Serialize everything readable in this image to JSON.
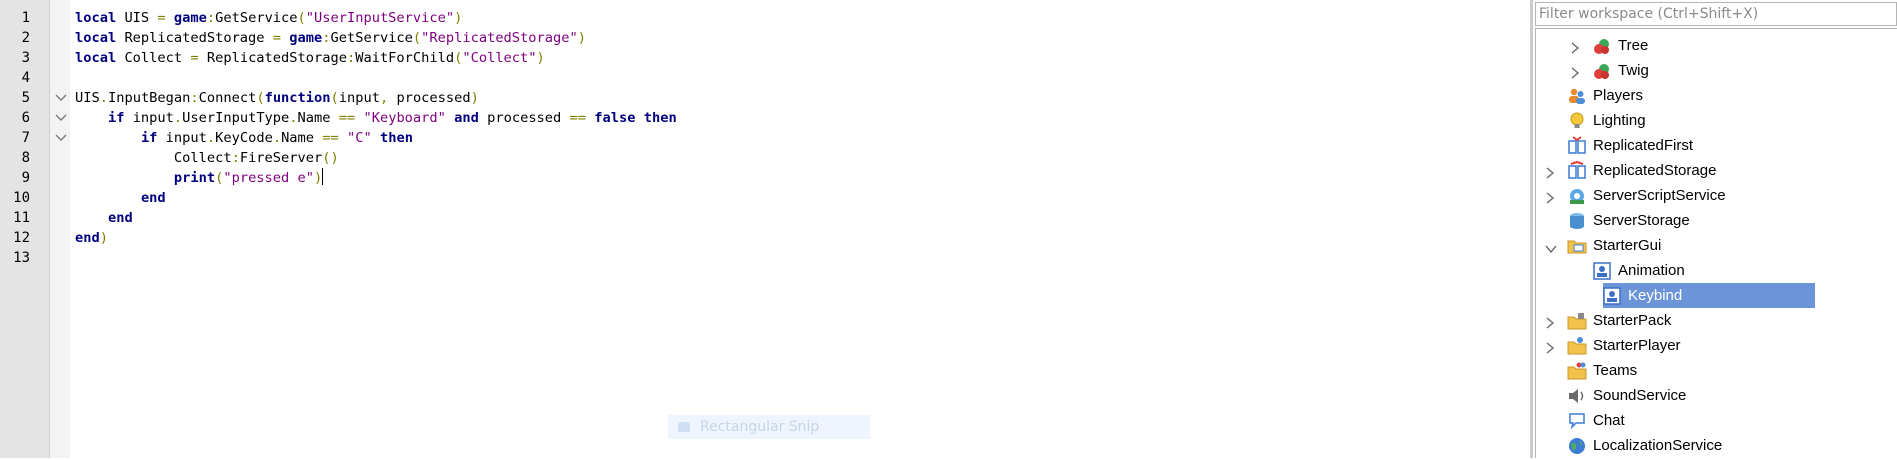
{
  "editor": {
    "line_numbers": [
      "1",
      "2",
      "3",
      "4",
      "5",
      "6",
      "7",
      "8",
      "9",
      "10",
      "11",
      "12",
      "13"
    ],
    "lines": [
      [
        [
          "local",
          "kw"
        ],
        [
          " UIS ",
          "id"
        ],
        [
          "=",
          "op"
        ],
        [
          " ",
          "id"
        ],
        [
          "game",
          "kw"
        ],
        [
          ":",
          "op"
        ],
        [
          "GetService",
          "id"
        ],
        [
          "(",
          "op"
        ],
        [
          "\"UserInputService\"",
          "str"
        ],
        [
          ")",
          "op"
        ]
      ],
      [
        [
          "local",
          "kw"
        ],
        [
          " ReplicatedStorage ",
          "id"
        ],
        [
          "=",
          "op"
        ],
        [
          " ",
          "id"
        ],
        [
          "game",
          "kw"
        ],
        [
          ":",
          "op"
        ],
        [
          "GetService",
          "id"
        ],
        [
          "(",
          "op"
        ],
        [
          "\"ReplicatedStorage\"",
          "str"
        ],
        [
          ")",
          "op"
        ]
      ],
      [
        [
          "local",
          "kw"
        ],
        [
          " Collect ",
          "id"
        ],
        [
          "=",
          "op"
        ],
        [
          " ReplicatedStorage",
          "id"
        ],
        [
          ":",
          "op"
        ],
        [
          "WaitForChild",
          "id"
        ],
        [
          "(",
          "op"
        ],
        [
          "\"Collect\"",
          "str"
        ],
        [
          ")",
          "op"
        ]
      ],
      [],
      [
        [
          "UIS",
          "id"
        ],
        [
          ".",
          "op"
        ],
        [
          "InputBegan",
          "id"
        ],
        [
          ":",
          "op"
        ],
        [
          "Connect",
          "id"
        ],
        [
          "(",
          "op"
        ],
        [
          "function",
          "kw"
        ],
        [
          "(",
          "op"
        ],
        [
          "input",
          "id"
        ],
        [
          ",",
          "op"
        ],
        [
          " processed",
          "id"
        ],
        [
          ")",
          "op"
        ]
      ],
      [
        [
          "    ",
          "id"
        ],
        [
          "if",
          "kw"
        ],
        [
          " input",
          "id"
        ],
        [
          ".",
          "op"
        ],
        [
          "UserInputType",
          "id"
        ],
        [
          ".",
          "op"
        ],
        [
          "Name ",
          "id"
        ],
        [
          "==",
          "op"
        ],
        [
          " ",
          "id"
        ],
        [
          "\"Keyboard\"",
          "str"
        ],
        [
          " ",
          "id"
        ],
        [
          "and",
          "kw"
        ],
        [
          " processed ",
          "id"
        ],
        [
          "==",
          "op"
        ],
        [
          " ",
          "id"
        ],
        [
          "false",
          "kw"
        ],
        [
          " ",
          "id"
        ],
        [
          "then",
          "kw"
        ]
      ],
      [
        [
          "        ",
          "id"
        ],
        [
          "if",
          "kw"
        ],
        [
          " input",
          "id"
        ],
        [
          ".",
          "op"
        ],
        [
          "KeyCode",
          "id"
        ],
        [
          ".",
          "op"
        ],
        [
          "Name ",
          "id"
        ],
        [
          "==",
          "op"
        ],
        [
          " ",
          "id"
        ],
        [
          "\"C\"",
          "str"
        ],
        [
          " ",
          "id"
        ],
        [
          "then",
          "kw"
        ]
      ],
      [
        [
          "            Collect",
          "id"
        ],
        [
          ":",
          "op"
        ],
        [
          "FireServer",
          "id"
        ],
        [
          "()",
          "op"
        ]
      ],
      [
        [
          "            ",
          "id"
        ],
        [
          "print",
          "kw"
        ],
        [
          "(",
          "op"
        ],
        [
          "\"pressed e\"",
          "str"
        ],
        [
          ")",
          "op"
        ]
      ],
      [
        [
          "        ",
          "id"
        ],
        [
          "end",
          "kw"
        ]
      ],
      [
        [
          "    ",
          "id"
        ],
        [
          "end",
          "kw"
        ]
      ],
      [
        [
          "end",
          "kw"
        ],
        [
          ")",
          "op"
        ]
      ],
      []
    ],
    "fold_lines": [
      5,
      6,
      7
    ],
    "caret_line": 9,
    "snip_hint": "Rectangular Snip"
  },
  "explorer": {
    "filter_placeholder": "Filter workspace (Ctrl+Shift+X)",
    "items": [
      {
        "label": "Tree",
        "icon": "model-icon",
        "indent": 1,
        "chevron": "right",
        "selected": false
      },
      {
        "label": "Twig",
        "icon": "model-icon",
        "indent": 1,
        "chevron": "right",
        "selected": false
      },
      {
        "label": "Players",
        "icon": "players-icon",
        "indent": 0,
        "chevron": "none",
        "selected": false
      },
      {
        "label": "Lighting",
        "icon": "lightbulb-icon",
        "indent": 0,
        "chevron": "none",
        "selected": false
      },
      {
        "label": "ReplicatedFirst",
        "icon": "replicated-first-icon",
        "indent": 0,
        "chevron": "none",
        "selected": false
      },
      {
        "label": "ReplicatedStorage",
        "icon": "replicated-storage-icon",
        "indent": 0,
        "chevron": "right",
        "selected": false
      },
      {
        "label": "ServerScriptService",
        "icon": "server-script-service-icon",
        "indent": 0,
        "chevron": "right",
        "selected": false
      },
      {
        "label": "ServerStorage",
        "icon": "server-storage-icon",
        "indent": 0,
        "chevron": "none",
        "selected": false
      },
      {
        "label": "StarterGui",
        "icon": "starter-gui-icon",
        "indent": 0,
        "chevron": "down",
        "selected": false
      },
      {
        "label": "Animation",
        "icon": "local-script-icon",
        "indent": 1,
        "chevron": "none",
        "selected": false
      },
      {
        "label": "Keybind",
        "icon": "local-script-icon",
        "indent": 1,
        "chevron": "none",
        "selected": true
      },
      {
        "label": "StarterPack",
        "icon": "starter-pack-icon",
        "indent": 0,
        "chevron": "right",
        "selected": false
      },
      {
        "label": "StarterPlayer",
        "icon": "starter-player-icon",
        "indent": 0,
        "chevron": "right",
        "selected": false
      },
      {
        "label": "Teams",
        "icon": "teams-icon",
        "indent": 0,
        "chevron": "none",
        "selected": false
      },
      {
        "label": "SoundService",
        "icon": "speaker-icon",
        "indent": 0,
        "chevron": "none",
        "selected": false
      },
      {
        "label": "Chat",
        "icon": "chat-bubble-icon",
        "indent": 0,
        "chevron": "none",
        "selected": false
      },
      {
        "label": "LocalizationService",
        "icon": "globe-icon",
        "indent": 0,
        "chevron": "none",
        "selected": false
      }
    ]
  },
  "colors": {
    "keyword": "#00007f",
    "string": "#7f007f",
    "operator": "#7f7f00",
    "selection": "#6b95d8",
    "gutter": "#e4e4e4"
  }
}
